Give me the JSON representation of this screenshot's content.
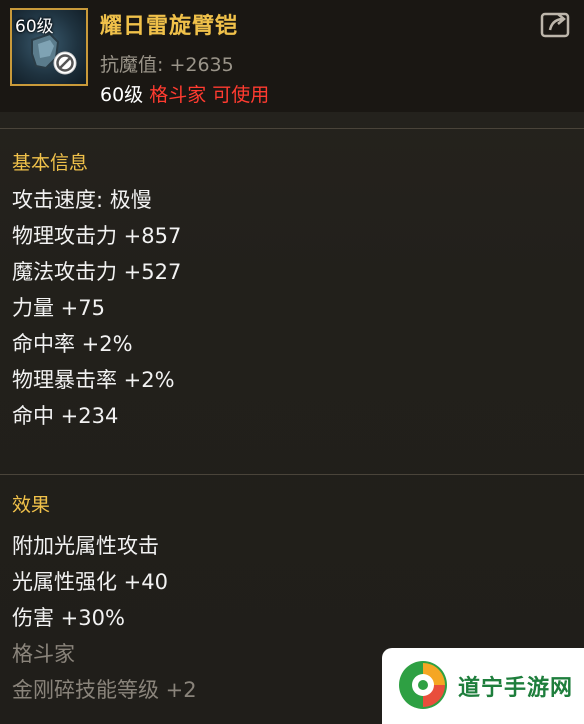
{
  "item": {
    "level_tag": "60级",
    "name": "耀日雷旋臂铠",
    "resist_label": "抗魔值:",
    "resist_value": "+2635",
    "req_level": "60级",
    "req_class": "格斗家",
    "req_usable": "可使用"
  },
  "basic": {
    "title": "基本信息",
    "stats": [
      "攻击速度: 极慢",
      "物理攻击力 +857",
      "魔法攻击力 +527",
      "力量 +75",
      "命中率 +2%",
      "物理暴击率 +2%",
      "命中 +234"
    ]
  },
  "effect": {
    "title": "效果",
    "lines": [
      "附加光属性攻击",
      "光属性强化 +40",
      "伤害 +30%"
    ],
    "class_name": "格斗家",
    "skill_line": "金刚碎技能等级 +2"
  },
  "watermark": {
    "text": "道宁手游网"
  },
  "icons": {
    "share": "share-icon",
    "ban": "ban-icon",
    "logo": "site-logo"
  },
  "colors": {
    "title": "#f0c14a",
    "class_red": "#ff3b30",
    "rare_border": "#c99a3a"
  }
}
